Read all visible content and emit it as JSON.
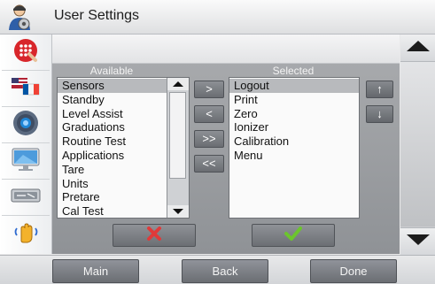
{
  "app": {
    "title": "User Settings",
    "title_icon": "user-settings-icon"
  },
  "sidebar": {
    "items": [
      {
        "icon": "keypad-icon"
      },
      {
        "icon": "flags-icon"
      },
      {
        "icon": "speaker-icon"
      },
      {
        "icon": "monitor-icon"
      },
      {
        "icon": "cable-icon"
      },
      {
        "icon": "hand-vibration-icon"
      }
    ]
  },
  "lists": {
    "available_header": "Available",
    "selected_header": "Selected",
    "available": [
      "Sensors",
      "Standby",
      "Level Assist",
      "Graduations",
      "Routine Test",
      "Applications",
      "Tare",
      "Units",
      "Pretare",
      "Cal Test"
    ],
    "available_selected_index": 0,
    "selected": [
      "Logout",
      "Print",
      "Zero",
      "Ionizer",
      "Calibration",
      "Menu"
    ],
    "selected_selected_index": 0
  },
  "move_buttons": {
    "add": ">",
    "remove": "<",
    "add_all": ">>",
    "remove_all": "<<"
  },
  "order_buttons": {
    "up": "↑",
    "down": "↓"
  },
  "action_buttons": {
    "cancel_icon": "x-icon",
    "confirm_icon": "check-icon"
  },
  "nav": {
    "main": "Main",
    "back": "Back",
    "done": "Done"
  },
  "colors": {
    "cancel": "#e03a3a",
    "confirm": "#6cc52d",
    "panel_gray": "#9a9da1"
  }
}
